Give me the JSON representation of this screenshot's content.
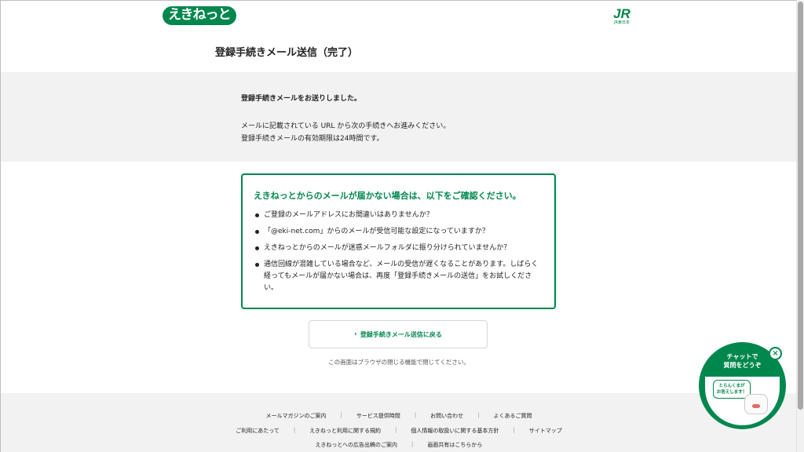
{
  "header": {
    "logo_text": "えきねっと",
    "jr_mark": "JR",
    "jr_sub": "JR東日本"
  },
  "page_title": "登録手続きメール送信（完了）",
  "summary": {
    "line1": "登録手続きメールをお送りしました。",
    "line2": "メールに記載されている URL から次の手続きへお進みください。",
    "line3": "登録手続きメールの有効期限は24時間です。"
  },
  "notice": {
    "heading": "えきねっとからのメールが届かない場合は、以下をご確認ください。",
    "items": [
      "ご登録のメールアドレスにお間違いはありませんか？",
      "「@eki-net.com」からのメールが受信可能な設定になっていますか？",
      "えきねっとからのメールが迷惑メールフォルダに振り分けられていませんか？",
      "通信回線が混雑している場合など、メールの受信が遅くなることがあります。しばらく経ってもメールが届かない場合は、再度「登録手続きメールの送信」をお試しください。"
    ]
  },
  "back_button": {
    "label": "登録手続きメール送信に戻る",
    "icon": "chevron-left-icon"
  },
  "close_note": "この画面はブラウザの閉じる機能で閉じてください。",
  "footer": {
    "row1": [
      "メールマガジンのご案内",
      "サービス提供時間",
      "お問い合わせ",
      "よくあるご質問"
    ],
    "row2": [
      "ご利用にあたって",
      "えきねっと利用に関する規約",
      "個人情報の取扱いに関する基本方針",
      "サイトマップ"
    ],
    "row3": [
      "えきねっとへの広告出稿のご案内",
      "画面共有はこちらから"
    ]
  },
  "chat": {
    "title_line1": "チャットで",
    "title_line2": "質問をどうぞ",
    "bubble_line1": "とらんくまが",
    "bubble_line2": "お答えします！",
    "close_icon": "close-icon"
  },
  "colors": {
    "brand_green": "#00874d",
    "band_grey": "#f2f2f2"
  }
}
